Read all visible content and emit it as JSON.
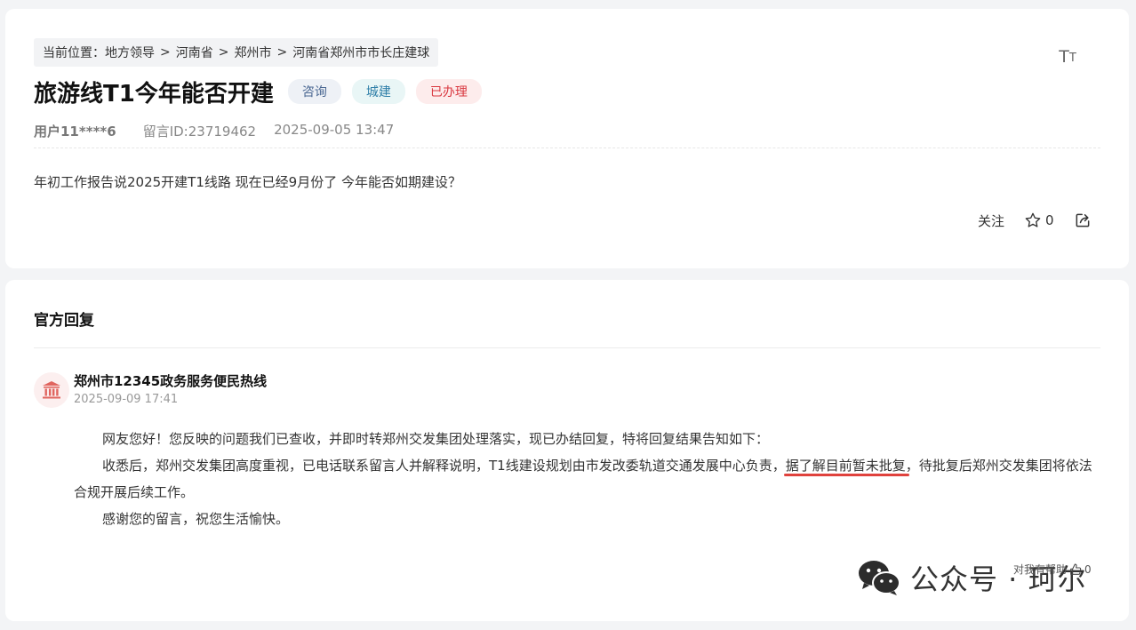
{
  "breadcrumb": {
    "prefix": "当前位置：",
    "items": [
      "地方领导",
      "河南省",
      "郑州市",
      "河南省郑州市市长庄建球"
    ],
    "separator": ">"
  },
  "font_size_toggle": {
    "big": "T",
    "small": "T"
  },
  "post": {
    "title": "旅游线T1今年能否开建",
    "tags": {
      "consult": "咨询",
      "city": "城建",
      "status": "已办理"
    },
    "user": "用户11****6",
    "message_id": "留言ID:23719462",
    "datetime": "2025-09-05 13:47",
    "question": "年初工作报告说2025开建T1线路 现在已经9月份了 今年能否如期建设？"
  },
  "actions": {
    "follow": "关注",
    "star_count": "0"
  },
  "reply": {
    "section_title": "官方回复",
    "org_name": "郑州市12345政务服务便民热线",
    "time": "2025-09-09 17:41",
    "para1": "网友您好！您反映的问题我们已查收，并即时转郑州交发集团处理落实，现已办结回复，特将回复结果告知如下：",
    "para2_a": "收悉后，郑州交发集团高度重视，已电话联系留言人并解释说明，T1线建设规划由市发改委轨道交通发展中心负责，",
    "para2_highlight": "据了解目前暂未批复",
    "para2_b": "，待批复后郑州交发集团将依法合规开展后续工作。",
    "para3": "感谢您的留言，祝您生活愉快。"
  },
  "helpful": {
    "label": "对我有帮助",
    "count": "0"
  },
  "watermark": {
    "text": "公众号 · 珂尔"
  },
  "colors": {
    "status_red": "#d9373f",
    "underline_red": "#e0423d",
    "tag_consult": "#4a6792",
    "tag_city": "#2f7fa8"
  }
}
